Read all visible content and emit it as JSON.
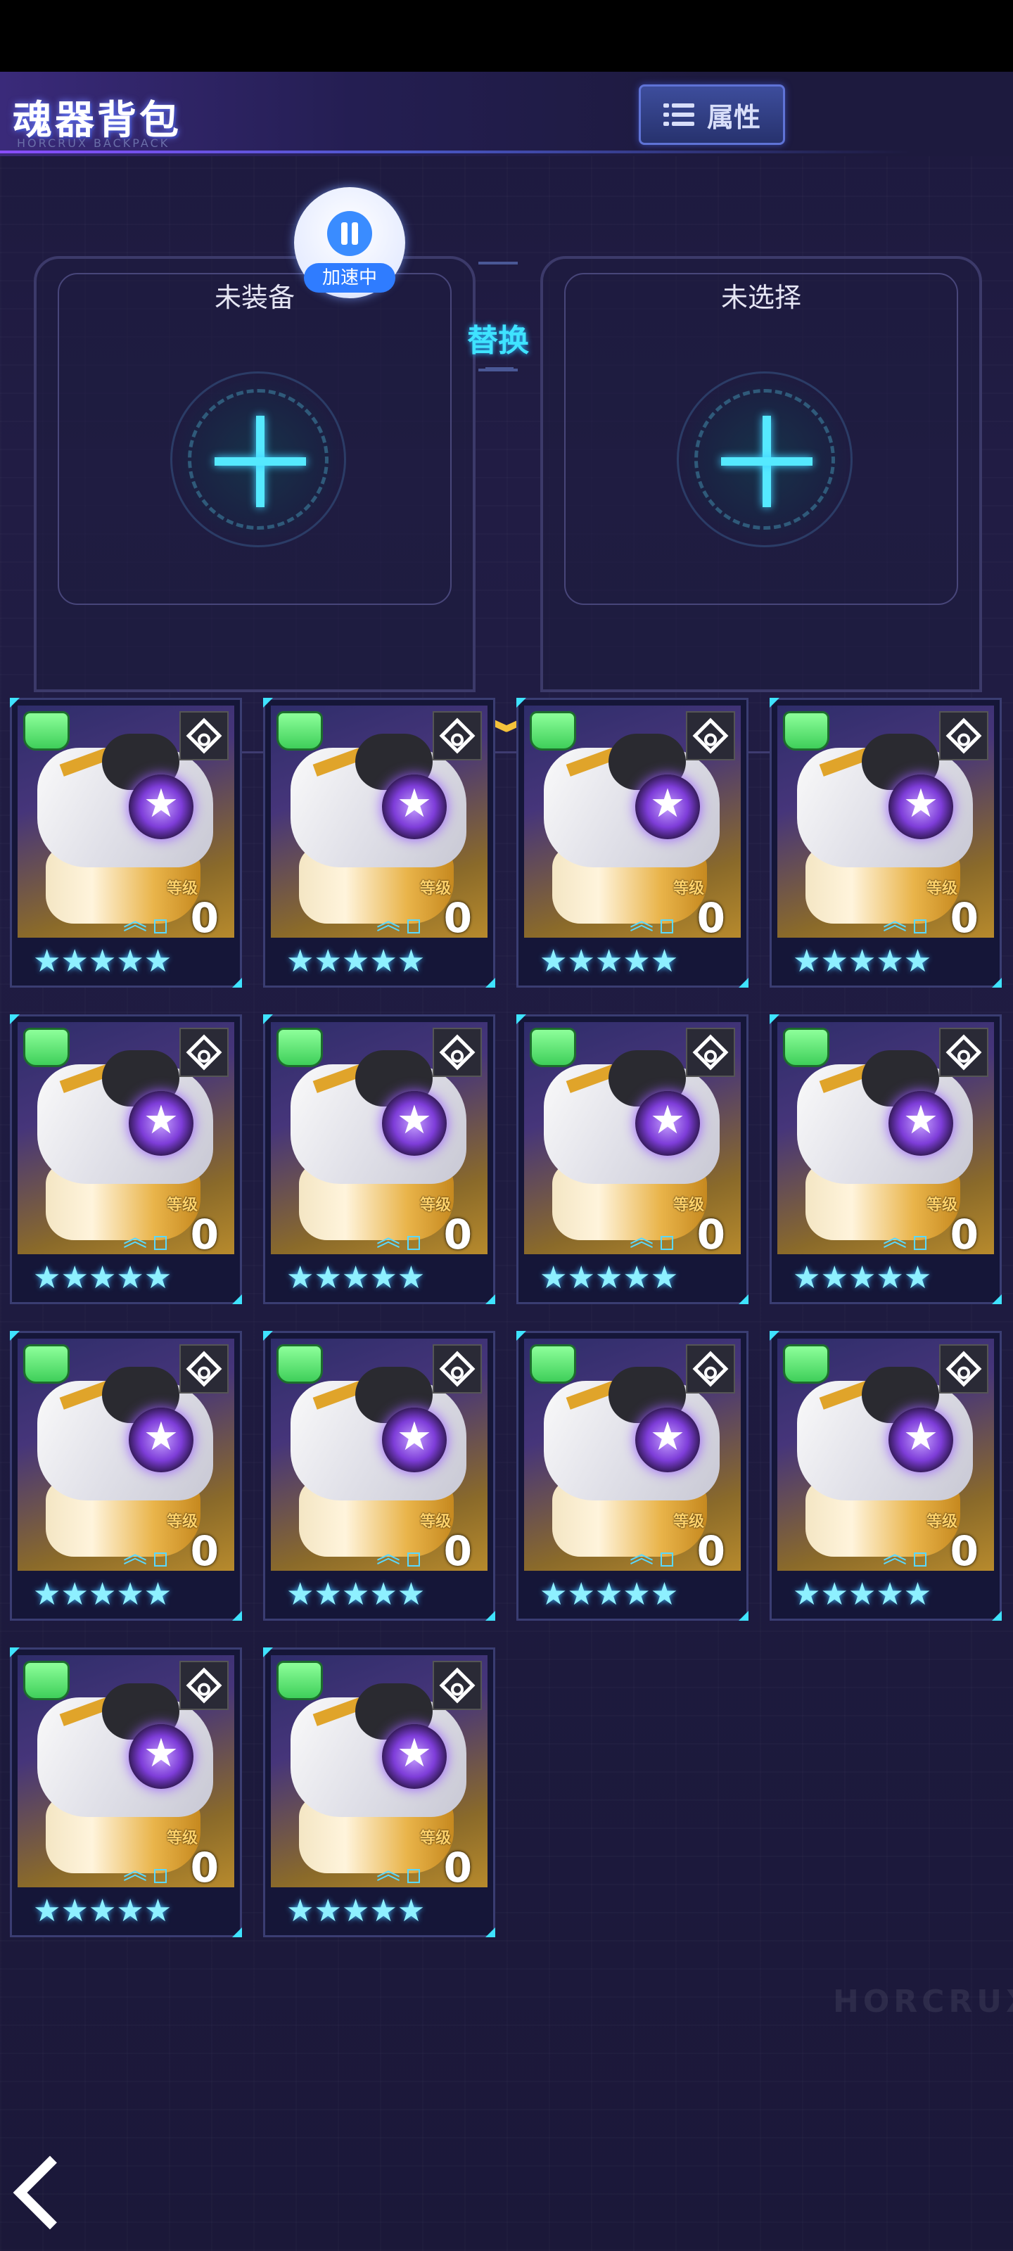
{
  "header": {
    "title": "魂器背包",
    "subtitle": "HORCRUX BACKPACK",
    "attr_button_label": "属性"
  },
  "equip": {
    "left_label": "未装备",
    "right_label": "未选择",
    "swap_label": "替换"
  },
  "overlay": {
    "speed_label": "加速中"
  },
  "cards": [
    {
      "level_label": "等级",
      "level": "0",
      "stars": 5,
      "star_text": "★★★★★"
    },
    {
      "level_label": "等级",
      "level": "0",
      "stars": 5,
      "star_text": "★★★★★"
    },
    {
      "level_label": "等级",
      "level": "0",
      "stars": 5,
      "star_text": "★★★★★"
    },
    {
      "level_label": "等级",
      "level": "0",
      "stars": 5,
      "star_text": "★★★★★"
    },
    {
      "level_label": "等级",
      "level": "0",
      "stars": 5,
      "star_text": "★★★★★"
    },
    {
      "level_label": "等级",
      "level": "0",
      "stars": 5,
      "star_text": "★★★★★"
    },
    {
      "level_label": "等级",
      "level": "0",
      "stars": 5,
      "star_text": "★★★★★"
    },
    {
      "level_label": "等级",
      "level": "0",
      "stars": 5,
      "star_text": "★★★★★"
    },
    {
      "level_label": "等级",
      "level": "0",
      "stars": 5,
      "star_text": "★★★★★"
    },
    {
      "level_label": "等级",
      "level": "0",
      "stars": 5,
      "star_text": "★★★★★"
    },
    {
      "level_label": "等级",
      "level": "0",
      "stars": 5,
      "star_text": "★★★★★"
    },
    {
      "level_label": "等级",
      "level": "0",
      "stars": 5,
      "star_text": "★★★★★"
    },
    {
      "level_label": "等级",
      "level": "0",
      "stars": 5,
      "star_text": "★★★★★"
    },
    {
      "level_label": "等级",
      "level": "0",
      "stars": 5,
      "star_text": "★★★★★"
    }
  ],
  "watermark": "HORCRUX",
  "colors": {
    "accent_cyan": "#3fe3ff",
    "level_gold": "#ffd26a",
    "speed_blue": "#2f7cff",
    "background": "#1e1b40"
  },
  "icons": {
    "attr": "list-icon",
    "add": "plus-icon",
    "expand": "chevron-down-icon",
    "back": "back-arrow-icon",
    "card_type": "cylinder-type-icon",
    "card_lock": "diamond-lock-icon",
    "rank": "double-chevron-up-icon"
  }
}
